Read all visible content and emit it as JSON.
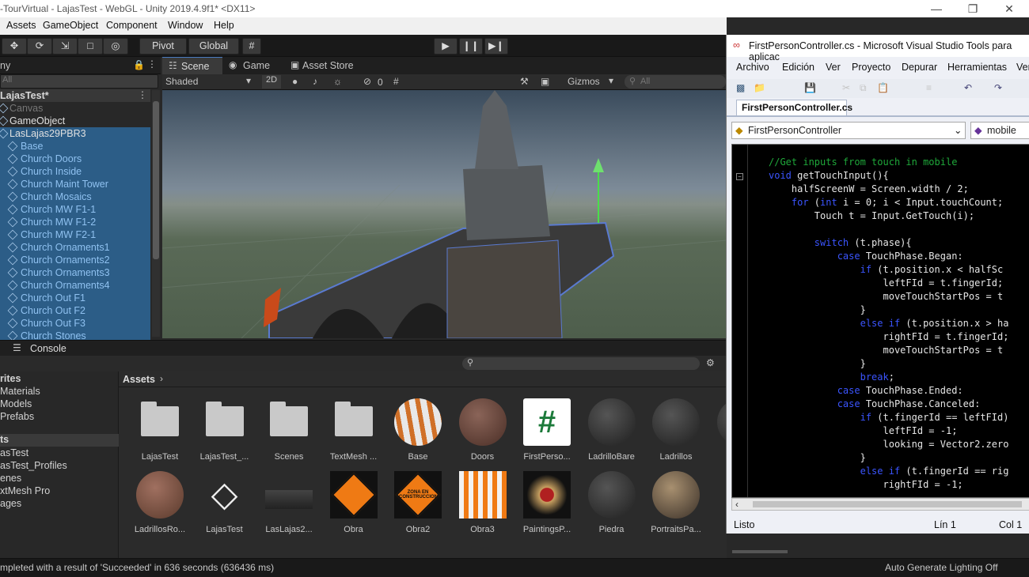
{
  "window": {
    "title": "-TourVirtual - LajasTest - WebGL - Unity 2019.4.9f1* <DX11>"
  },
  "menu": [
    "Assets",
    "GameObject",
    "Component",
    "Window",
    "Help"
  ],
  "toolbar": {
    "pivot": "Pivot",
    "global": "Global"
  },
  "hierarchy": {
    "tab": "ny",
    "search": "All",
    "scene": "LajasTest*",
    "items": [
      "Canvas",
      "GameObject",
      "LasLajas29PBR3",
      "Base",
      "Church Doors",
      "Church Inside",
      "Church Maint Tower",
      "Church Mosaics",
      "Church MW F1-1",
      "Church MW F1-2",
      "Church MW F2-1",
      "Church Ornaments1",
      "Church Ornaments2",
      "Church Ornaments3",
      "Church Ornaments4",
      "Church Out F1",
      "Church Out F2",
      "Church Out F3",
      "Church Stones"
    ]
  },
  "scene_tabs": {
    "scene": "Scene",
    "game": "Game",
    "store": "Asset Store"
  },
  "scene_opts": {
    "shading": "Shaded",
    "two_d": "2D",
    "hidden_count": "0",
    "gizmos": "Gizmos",
    "search": "All"
  },
  "console": {
    "tab": "Console"
  },
  "project": {
    "left_items": [
      "rites",
      "Materials",
      "Models",
      "Prefabs",
      "ts",
      "asTest",
      "asTest_Profiles",
      "enes",
      "xtMesh Pro",
      "ages"
    ],
    "breadcrumb": "Assets",
    "assets_row1": [
      "LajasTest",
      "LajasTest_...",
      "Scenes",
      "TextMesh ...",
      "Base",
      "Doors",
      "FirstPerso...",
      "LadrilloBare",
      "Ladrillos",
      "La"
    ],
    "assets_row2": [
      "LadrillosRo...",
      "LajasTest",
      "LasLajas2...",
      "Obra",
      "Obra2",
      "Obra3",
      "PaintingsP...",
      "Piedra",
      "PortraitsPa..."
    ],
    "sign_text": "ZONA EN CONSTRUCCION"
  },
  "status": {
    "left": "mpleted with a result of 'Succeeded' in 636 seconds (636436 ms)",
    "right": "Auto Generate Lighting Off"
  },
  "vs": {
    "title": "FirstPersonController.cs - Microsoft Visual Studio Tools para aplicac",
    "menu": [
      "Archivo",
      "Edición",
      "Ver",
      "Proyecto",
      "Depurar",
      "Herramientas",
      "Ver"
    ],
    "tab": "FirstPersonController.cs",
    "class_combo": "FirstPersonController",
    "member_combo": "mobile",
    "code": [
      [
        [
          "cm",
          "//Get inputs from touch in mobile"
        ]
      ],
      [
        [
          "kw",
          "void"
        ],
        [
          "tx",
          " getTouchInput(){"
        ]
      ],
      [
        [
          "tx",
          "    halfScreenW = Screen.width / 2;"
        ]
      ],
      [
        [
          "kw",
          "    for"
        ],
        [
          "tx",
          " ("
        ],
        [
          "kw",
          "int"
        ],
        [
          "tx",
          " i = 0; i < Input.touchCount;"
        ]
      ],
      [
        [
          "tx",
          "        Touch t = Input.GetTouch(i);"
        ]
      ],
      [
        [
          "tx",
          ""
        ]
      ],
      [
        [
          "kw",
          "        switch"
        ],
        [
          "tx",
          " (t.phase){"
        ]
      ],
      [
        [
          "kw",
          "            case"
        ],
        [
          "tx",
          " TouchPhase.Began:"
        ]
      ],
      [
        [
          "kw",
          "                if"
        ],
        [
          "tx",
          " (t.position.x < halfSc"
        ]
      ],
      [
        [
          "tx",
          "                    leftFId = t.fingerId;"
        ]
      ],
      [
        [
          "tx",
          "                    moveTouchStartPos = t"
        ]
      ],
      [
        [
          "tx",
          "                }"
        ]
      ],
      [
        [
          "kw",
          "                else if"
        ],
        [
          "tx",
          " (t.position.x > ha"
        ]
      ],
      [
        [
          "tx",
          "                    rightFId = t.fingerId;"
        ]
      ],
      [
        [
          "tx",
          "                    moveTouchStartPos = t"
        ]
      ],
      [
        [
          "tx",
          "                }"
        ]
      ],
      [
        [
          "kw",
          "                break"
        ],
        [
          "tx",
          ";"
        ]
      ],
      [
        [
          "kw",
          "            case"
        ],
        [
          "tx",
          " TouchPhase.Ended:"
        ]
      ],
      [
        [
          "kw",
          "            case"
        ],
        [
          "tx",
          " TouchPhase.Canceled:"
        ]
      ],
      [
        [
          "kw",
          "                if"
        ],
        [
          "tx",
          " (t.fingerId == leftFId)"
        ]
      ],
      [
        [
          "tx",
          "                    leftFId = -1;"
        ]
      ],
      [
        [
          "tx",
          "                    looking = Vector2.zero"
        ]
      ],
      [
        [
          "tx",
          "                }"
        ]
      ],
      [
        [
          "kw",
          "                else if"
        ],
        [
          "tx",
          " (t.fingerId == rig"
        ]
      ],
      [
        [
          "tx",
          "                    rightFId = -1;"
        ]
      ]
    ],
    "status_left": "Listo",
    "status_line": "Lín 1",
    "status_col": "Col 1"
  },
  "colors": {
    "unity_bg": "#282828",
    "selection": "#2c5d87",
    "vs_bg": "#eef0f6",
    "code_keyword": "#3b55ff",
    "code_comment": "#1fa83a"
  }
}
